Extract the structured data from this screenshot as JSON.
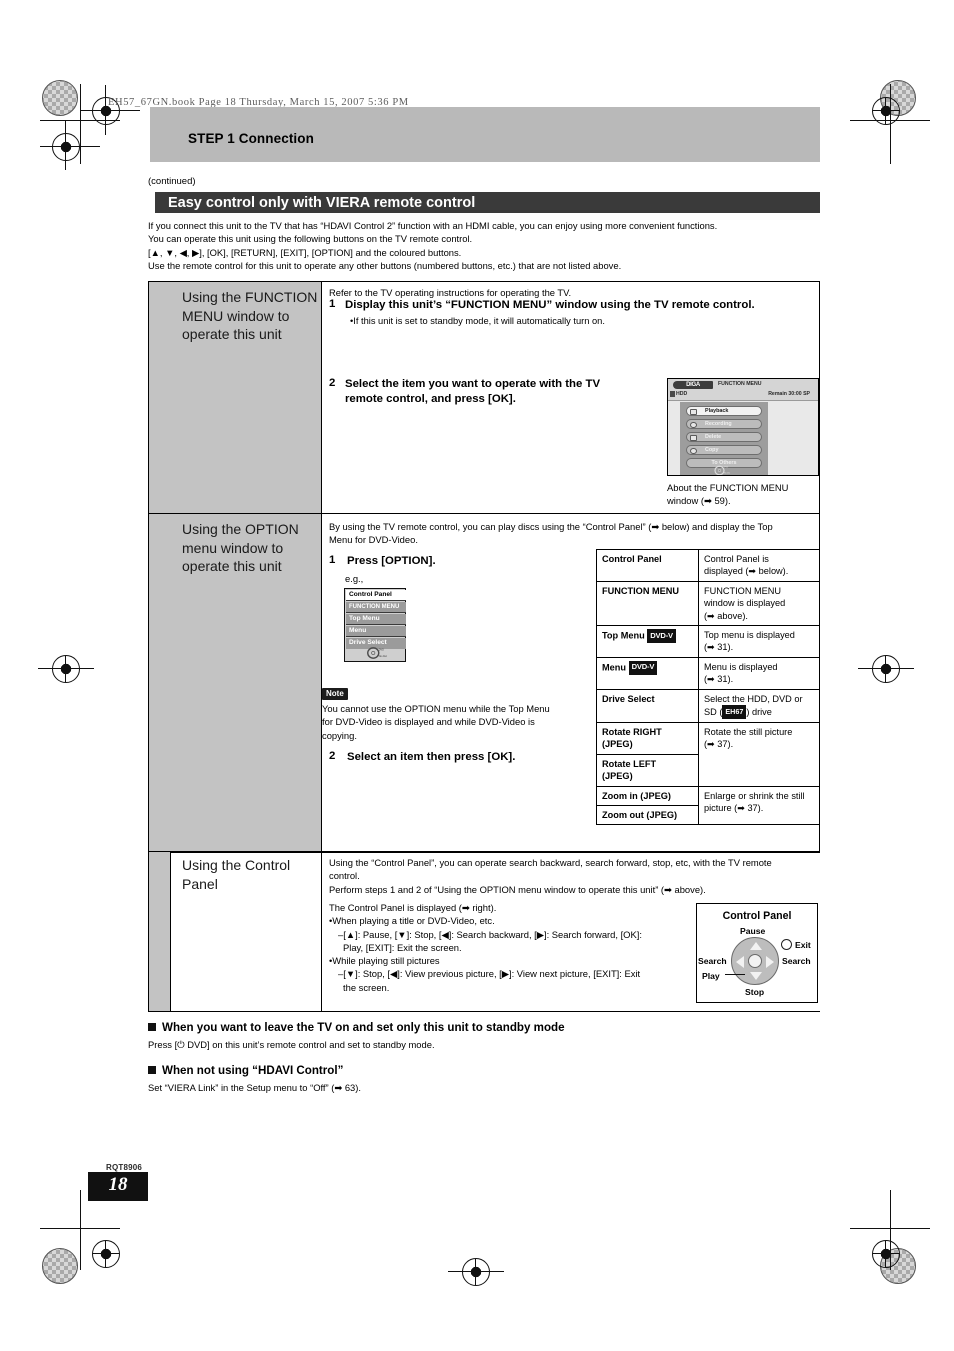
{
  "print_header": "EH57_67GN.book  Page 18  Thursday, March 15, 2007  5:36 PM",
  "step_title": "STEP 1  Connection",
  "continued": "(continued)",
  "section_title": "Easy control only with VIERA remote control",
  "intro": [
    "If you connect this unit to the TV that has “HDAVI Control 2” function with an HDMI cable, you can enjoy using more convenient functions.",
    "You can operate this unit using the following buttons on the TV remote control.",
    "[▲, ▼, ◀, ▶], [OK], [RETURN], [EXIT], [OPTION] and the coloured buttons.",
    "Use the remote control for this unit to operate any other buttons (numbered buttons, etc.) that are not listed above."
  ],
  "sections": {
    "function_menu": {
      "title": [
        "Using the FUNCTION",
        "MENU window to",
        "operate this unit"
      ],
      "lead": "Refer to the TV operating instructions for operating the TV.",
      "step1_no": "1",
      "step1": [
        "Display this unit’s “FUNCTION MENU” window using the TV remote control."
      ],
      "step1_bullet": "•If this unit is set to standby mode, it will automatically turn on.",
      "step2_no": "2",
      "step2": [
        "Select the item you want to operate with the TV",
        "remote control, and press [OK]."
      ],
      "tv_screen": {
        "logo": "DIGA",
        "header": "FUNCTION MENU",
        "drive": "HDD",
        "remain": "Remain  30:00 SP",
        "items": [
          "Playback",
          "Recording",
          "Delete",
          "Copy",
          "To Others"
        ],
        "selected": "Playback",
        "disc_label": "DVD",
        "disc_sub": "No disc"
      },
      "caption": [
        "About the FUNCTION MENU",
        "window (➡ 59)."
      ]
    },
    "option_menu": {
      "title": [
        "Using the OPTION",
        "menu window to",
        "operate this unit"
      ],
      "lead": [
        "By using the TV remote control, you can play discs using the “Control Panel” (➡ below) and display the Top",
        "Menu for DVD-Video."
      ],
      "step1_no": "1",
      "step1": "Press [OPTION].",
      "eg": "e.g.,",
      "option_graphic_items": [
        "Control Panel",
        "FUNCTION MENU",
        "Top Menu",
        "Menu",
        "Drive Select"
      ],
      "option_graphic_selected": "Control Panel",
      "note_badge": "Note",
      "note": [
        "You cannot use the OPTION menu while the Top Menu",
        "for DVD-Video is displayed and while DVD-Video is",
        "copying."
      ],
      "step2_no": "2",
      "step2": "Select an item then press [OK].",
      "table": [
        {
          "key": "Control Panel",
          "badge": "",
          "value": [
            "Control Panel is",
            "displayed (➡ below)."
          ]
        },
        {
          "key": "FUNCTION MENU",
          "badge": "",
          "value": [
            "FUNCTION MENU",
            "window is displayed",
            "(➡ above)."
          ]
        },
        {
          "key": "Top Menu",
          "badge": "DVD-V",
          "value": [
            "Top menu is displayed",
            "(➡ 31)."
          ]
        },
        {
          "key": "Menu",
          "badge": "DVD-V",
          "value": [
            "Menu is displayed",
            "(➡ 31)."
          ]
        },
        {
          "key": "Drive Select",
          "badge": "",
          "value": [
            "Select the HDD, DVD or",
            "SD (EH67) drive"
          ]
        },
        {
          "key": "Rotate RIGHT (JPEG)",
          "badge": "",
          "value": [
            "Rotate the still picture",
            "(➡ 37)."
          ]
        },
        {
          "key": "Rotate LEFT (JPEG)",
          "badge": "",
          "value": []
        },
        {
          "key": "Zoom in (JPEG)",
          "badge": "",
          "value": [
            "Enlarge or shrink the still",
            "picture (➡ 37)."
          ]
        },
        {
          "key": "Zoom out (JPEG)",
          "badge": "",
          "value": []
        }
      ]
    },
    "control_panel": {
      "title": [
        "Using the Control",
        "Panel"
      ],
      "lead": [
        "Using the “Control Panel”, you can operate search backward, search forward, stop, etc, with the TV remote",
        "control.",
        "Perform steps 1 and 2 of “Using the OPTION menu window to operate this unit” (➡ above)."
      ],
      "body": [
        "The Control Panel is displayed (➡ right).",
        "•When playing a title or DVD-Video, etc.",
        "–[▲]: Pause, [▼]: Stop, [◀]: Search backward, [▶]: Search forward, [OK]:",
        "Play, [EXIT]: Exit the screen.",
        "•While playing still pictures",
        "–[▼]: Stop, [◀]: View previous picture, [▶]: View next picture, [EXIT]: Exit",
        "the screen."
      ],
      "diagram": {
        "title": "Control Panel",
        "up": "Pause",
        "down": "Stop",
        "left": "Search",
        "right": "Search",
        "center": "Play",
        "exit": "Exit"
      }
    }
  },
  "bottom": [
    {
      "head": "When you want to leave the TV on and set only this unit to standby mode",
      "body": "Press [⏻ DVD] on this unit’s remote control and set to standby mode."
    },
    {
      "head": "When not using “HDAVI Control”",
      "body": "Set “VIERA Link” in the Setup menu to “Off” (➡ 63)."
    }
  ],
  "footer": {
    "code": "RQT8906",
    "page": "18"
  }
}
